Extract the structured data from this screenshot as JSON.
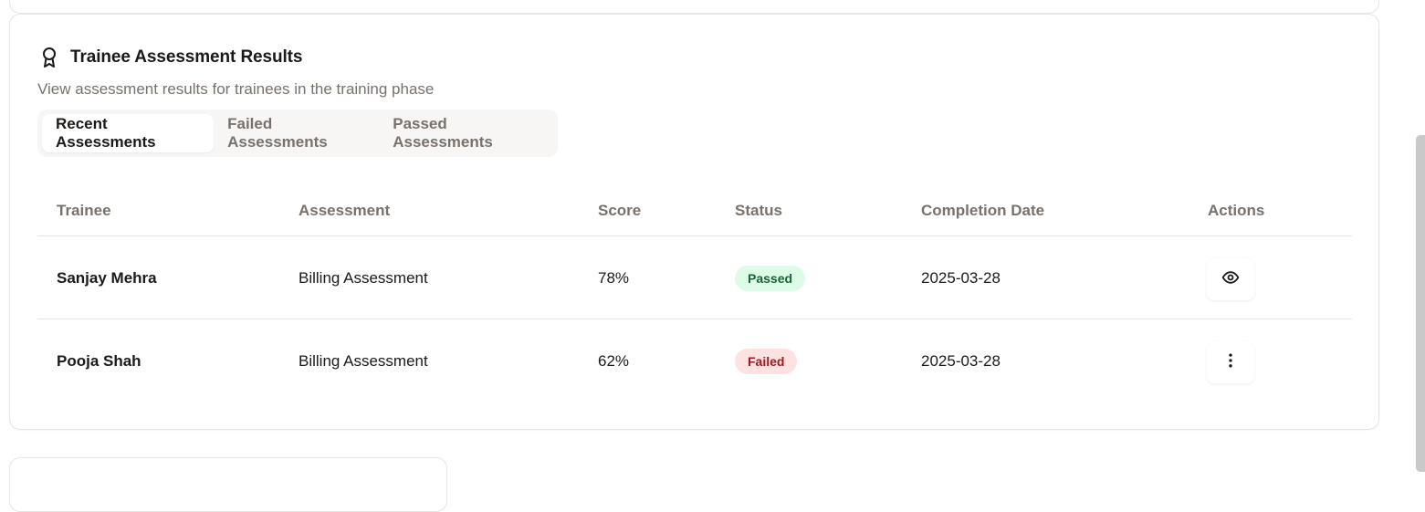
{
  "card": {
    "title": "Trainee Assessment Results",
    "subtitle": "View assessment results for trainees in the training phase",
    "icon": "award-icon"
  },
  "tabs": [
    {
      "label": "Recent Assessments",
      "active": true
    },
    {
      "label": "Failed Assessments",
      "active": false
    },
    {
      "label": "Passed Assessments",
      "active": false
    }
  ],
  "table": {
    "headers": [
      "Trainee",
      "Assessment",
      "Score",
      "Status",
      "Completion Date",
      "Actions"
    ],
    "rows": [
      {
        "trainee": "Sanjay Mehra",
        "assessment": "Billing Assessment",
        "score": "78%",
        "status": "Passed",
        "date": "2025-03-28",
        "action_icon": "eye-icon"
      },
      {
        "trainee": "Pooja Shah",
        "assessment": "Billing Assessment",
        "score": "62%",
        "status": "Failed",
        "date": "2025-03-28",
        "action_icon": "more-vertical-icon"
      }
    ]
  },
  "colors": {
    "passed_bg": "#dcfce7",
    "passed_text": "#166534",
    "failed_bg": "#fee2e2",
    "failed_text": "#991b1b"
  }
}
